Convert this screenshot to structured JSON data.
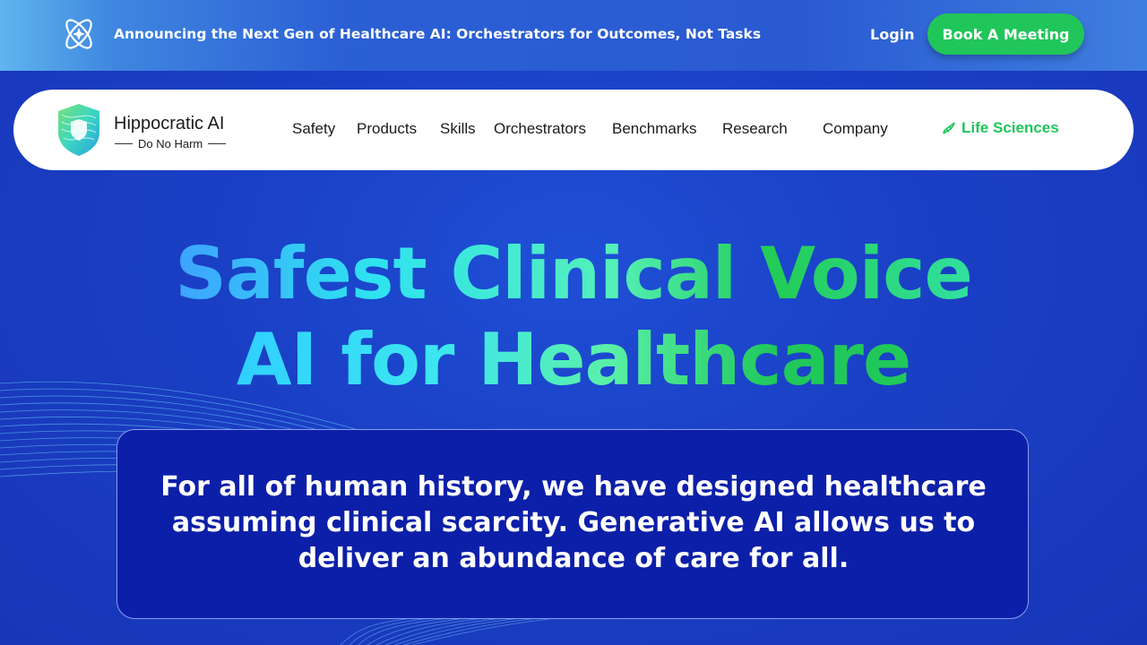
{
  "announcement": {
    "text": "Announcing the Next Gen of Healthcare AI: Orchestrators for Outcomes, Not Tasks",
    "login_label": "Login",
    "cta_label": "Book A Meeting",
    "logo_icon": "atom-star-icon"
  },
  "nav": {
    "brand_name": "Hippocratic AI",
    "brand_tagline": "Do No Harm",
    "brand_icon": "shield-logo-icon",
    "items": [
      {
        "label": "Safety"
      },
      {
        "label": "Products"
      },
      {
        "label": "Skills"
      },
      {
        "label": "Orchestrators"
      },
      {
        "label": "Benchmarks"
      },
      {
        "label": "Research"
      },
      {
        "label": "Company"
      }
    ],
    "highlight": {
      "label": "Life Sciences",
      "icon": "dna-icon"
    }
  },
  "hero": {
    "line1": "Safest Clinical Voice",
    "line2": "AI for Healthcare",
    "quote": "For all of human history, we have designed healthcare assuming clinical scarcity. Generative AI allows us to deliver an abundance of care for all."
  },
  "colors": {
    "accent_green": "#20c65a",
    "background_blue": "#1a3fc4",
    "quote_box": "#0c1fa8"
  }
}
